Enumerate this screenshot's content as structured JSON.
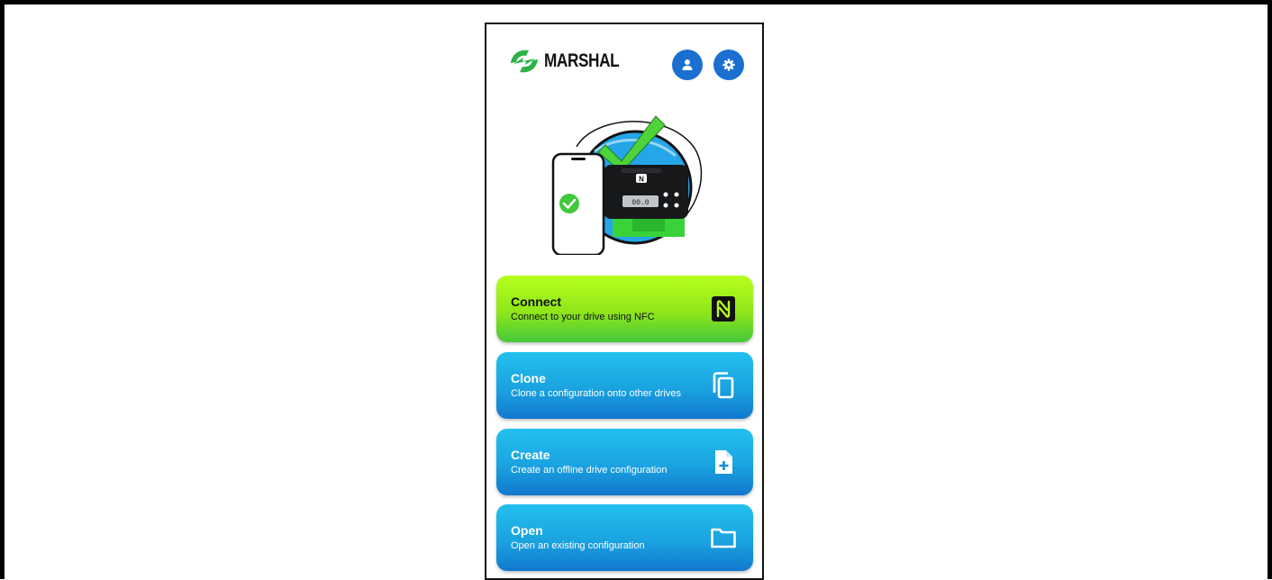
{
  "app": {
    "brand": "MARSHAL"
  },
  "header": {
    "profile_icon": "person-icon",
    "settings_icon": "gear-icon"
  },
  "illustration": {
    "display_readout": "00.0",
    "nfc_badge": "N"
  },
  "actions": [
    {
      "title": "Connect",
      "description": "Connect to your drive using NFC",
      "icon": "nfc-icon"
    },
    {
      "title": "Clone",
      "description": "Clone a configuration onto other drives",
      "icon": "copy-icon"
    },
    {
      "title": "Create",
      "description": "Create an offline drive configuration",
      "icon": "file-add-icon"
    },
    {
      "title": "Open",
      "description": "Open an existing configuration",
      "icon": "folder-icon"
    }
  ],
  "colors": {
    "brand_green": "#2db24a",
    "accent_blue": "#1a6fd1",
    "connect_green": "#9ef01e",
    "card_blue": "#1aa3e0"
  }
}
